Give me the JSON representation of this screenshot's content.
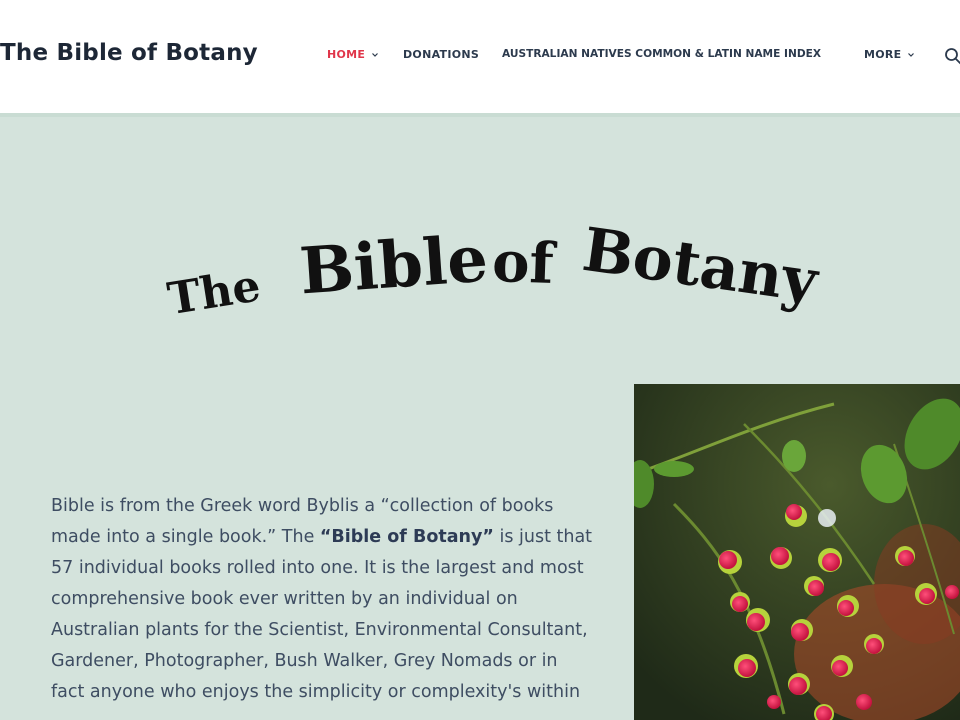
{
  "header": {
    "site_title": "The Bible of Botany",
    "nav": [
      {
        "label": "HOME",
        "has_dropdown": true,
        "active": true
      },
      {
        "label": "DONATIONS",
        "has_dropdown": false,
        "active": false
      },
      {
        "label": "AUSTRALIAN NATIVES COMMON & LATIN NAME INDEX",
        "has_dropdown": false,
        "active": false
      },
      {
        "label": "MORE",
        "has_dropdown": true,
        "active": false
      }
    ],
    "search_icon": "search-icon"
  },
  "hero": {
    "logo_words": [
      "The",
      "Bible",
      "of",
      "Botany"
    ]
  },
  "intro": {
    "p1": "Bible is from the Greek word Byblis a “collection of books made into a single book.” The ",
    "bold": "“Bible of Botany”",
    "p2": " is just that 57 individual books rolled into one. It is the largest and most comprehensive book ever written by an individual on Australian plants for the Scientist, Environmental Consultant, Gardener, Photographer, Bush Walker, Grey Nomads or in fact anyone who enjoys the simplicity or complexity's within"
  },
  "colors": {
    "accent": "#e0364a",
    "background": "#d4e3dc",
    "text": "#3e4d62",
    "title": "#1d2736"
  }
}
